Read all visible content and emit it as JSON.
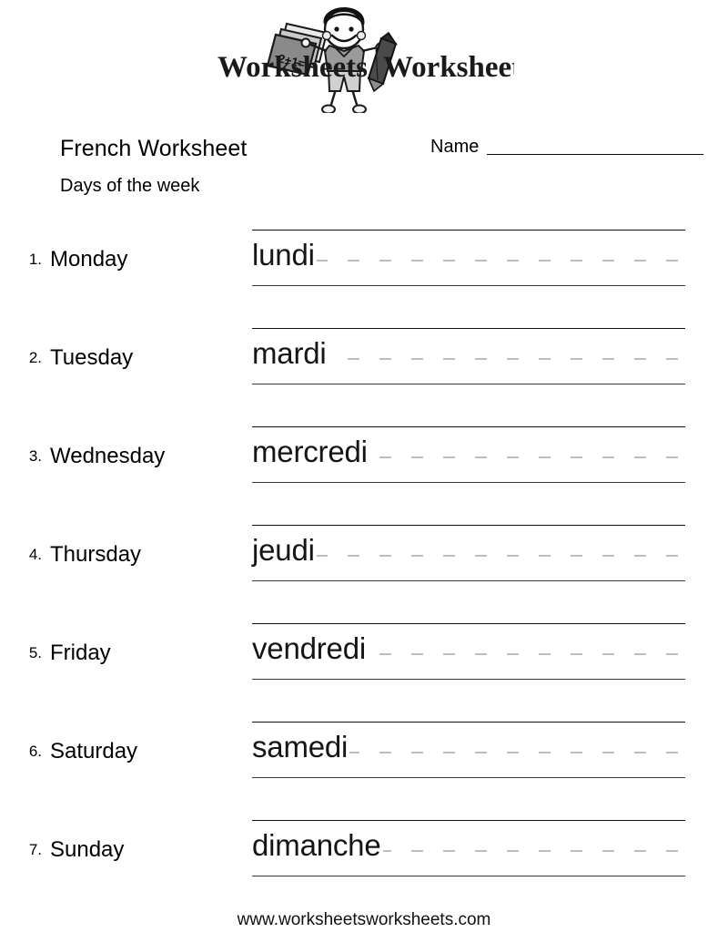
{
  "logo": {
    "word_left": "Worksheets",
    "word_right": "Worksheets",
    "notebook_text": "2+1=",
    "mascot_alt": "boy-with-pencil-and-notebook"
  },
  "header": {
    "title": "French Worksheet",
    "subtitle": "Days of the week",
    "name_label": "Name",
    "name_value": ""
  },
  "rows": [
    {
      "index": "1.",
      "english": "Monday",
      "french": "lundi"
    },
    {
      "index": "2.",
      "english": "Tuesday",
      "french": "mardi"
    },
    {
      "index": "3.",
      "english": "Wednesday",
      "french": "mercredi"
    },
    {
      "index": "4.",
      "english": "Thursday",
      "french": "jeudi"
    },
    {
      "index": "5.",
      "english": "Friday",
      "french": "vendredi"
    },
    {
      "index": "6.",
      "english": "Saturday",
      "french": "samedi"
    },
    {
      "index": "7.",
      "english": "Sunday",
      "french": "dimanche"
    }
  ],
  "footer": {
    "url": "www.worksheetsworksheets.com"
  },
  "colors": {
    "page_background": "#ffffff",
    "text": "#000000",
    "solid_rule": "#111111",
    "dashed_rule": "#bdbdbd",
    "french_word": "#151515"
  }
}
